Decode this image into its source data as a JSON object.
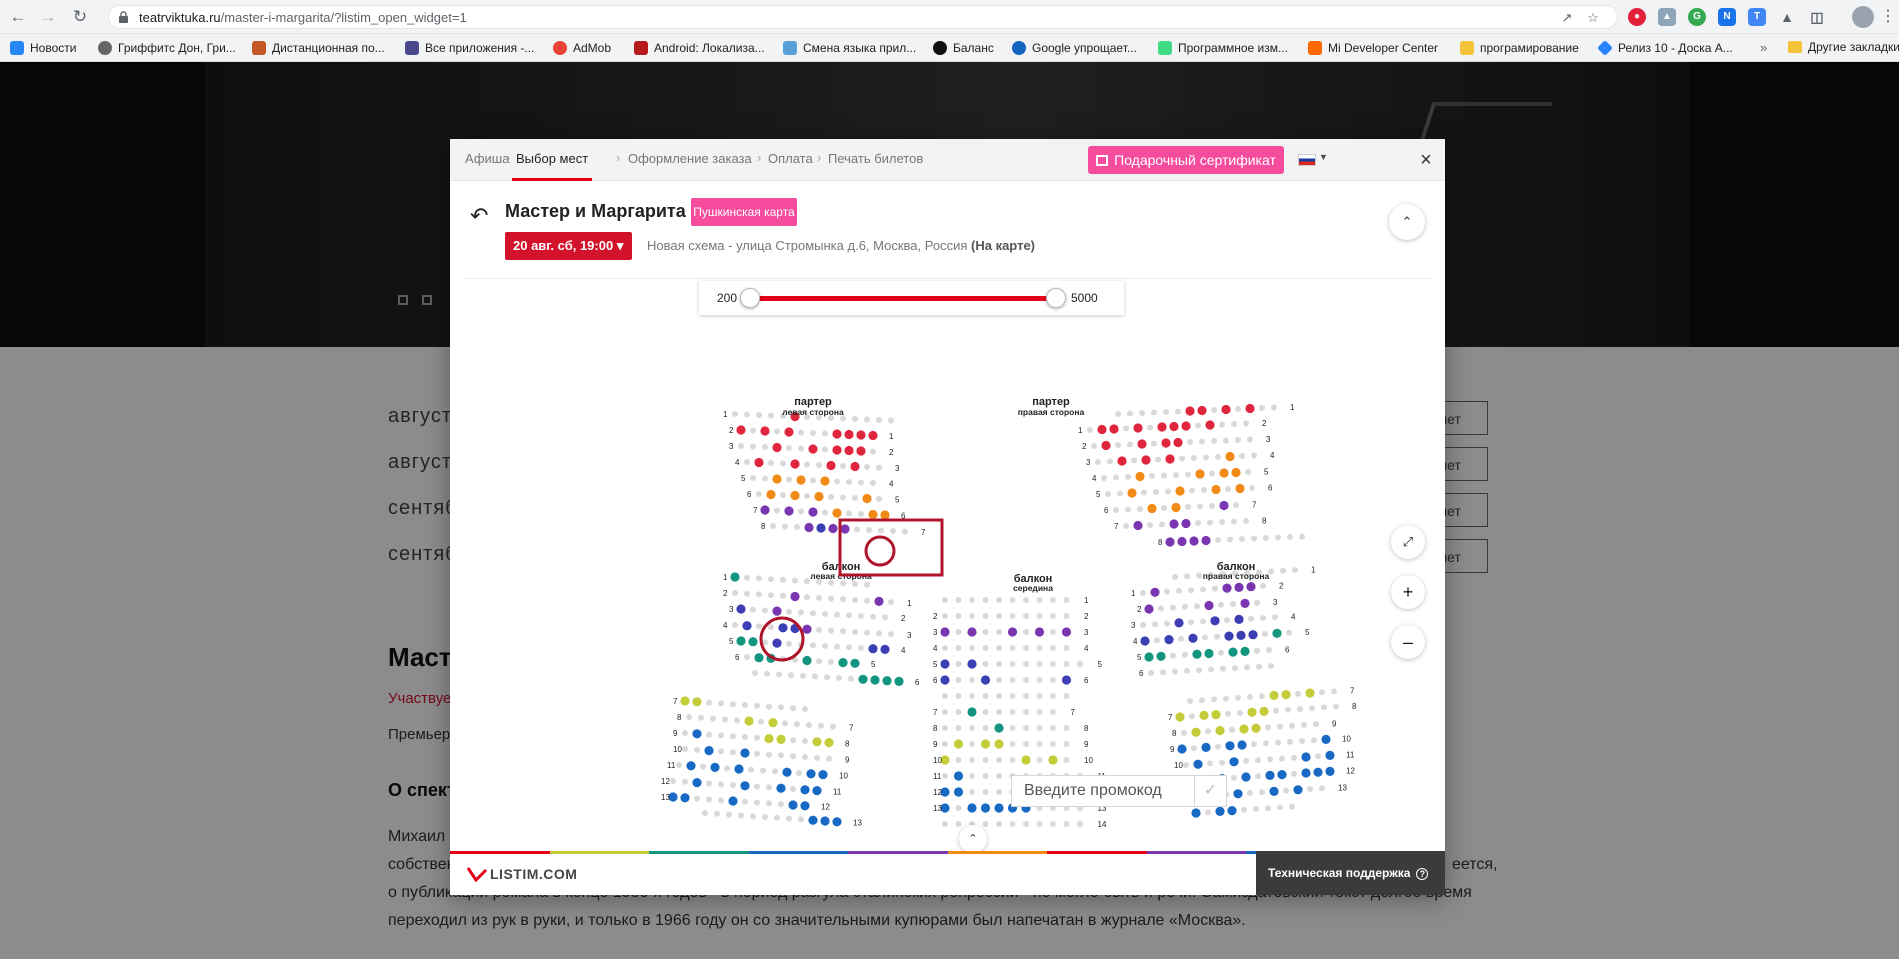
{
  "browser": {
    "url_domain": "teatrviktuka.ru",
    "url_path": "/master-i-margarita/?listim_open_widget=1",
    "bookmarks": [
      {
        "label": "Новости",
        "color": "#2787f5"
      },
      {
        "label": "Гриффитс Дон, Гри...",
        "color": "#666666"
      },
      {
        "label": "Дистанционная по...",
        "color": "#c2582a"
      },
      {
        "label": "Все приложения -...",
        "color": "#4a4a8a"
      },
      {
        "label": "AdMob",
        "color": "#ea4335"
      },
      {
        "label": "Android: Локализа...",
        "color": "#b71c1c"
      },
      {
        "label": "Смена языка прил...",
        "color": "#5aa0d8"
      },
      {
        "label": "Баланс",
        "color": "#111111"
      },
      {
        "label": "Google упрощает...",
        "color": "#1565c0"
      },
      {
        "label": "Программное изм...",
        "color": "#3ddc84"
      },
      {
        "label": "Mi Developer Center",
        "color": "#ff6900"
      },
      {
        "label": "програмирование",
        "color": "#f4c33a"
      },
      {
        "label": "Релиз 10 - Доска А...",
        "color": "#2684ff"
      }
    ],
    "bookmarks_more": "»",
    "bookmarks_other": "Другие закладки"
  },
  "page": {
    "date_rows": [
      "август",
      "август",
      "сентяб",
      "сентяб"
    ],
    "buy_label": "лет",
    "title": "Маст",
    "participates": "Участвуе",
    "premiere": "Премьер",
    "about_heading": "О спект",
    "paragraphs": [
      "Михаил А",
      "собствен",
      "о публикации романа в конце 1930-х годов - в период разгула сталинских репрессий - не могло быть и речи. Самиздатовский текст долгое время",
      "переходил из рук в руки, и только в 1966 году он со значительными купюрами был напечатан в журнале «Москва»."
    ],
    "para_right_fragment": "еется,"
  },
  "widget": {
    "steps": [
      "Афиша",
      "Выбор мест",
      "Оформление заказа",
      "Оплата",
      "Печать билетов"
    ],
    "active_step": "Выбор мест",
    "gift_button": "Подарочный сертификат",
    "close_icon": "×",
    "event_title": "Мастер и Маргарита",
    "pushkin_badge": "Пушкинская карта",
    "date_button": "20 авг. сб, 19:00",
    "venue": "Новая схема - улица Стромынка д.6, Москва, Россия",
    "venue_map_link": "(На карте)",
    "price_filter": {
      "min": "200",
      "max": "5000",
      "min_value": 200,
      "max_value": 5000
    },
    "sections": [
      {
        "title": "партер",
        "subtitle": "левая сторона"
      },
      {
        "title": "партер",
        "subtitle": "правая сторона"
      },
      {
        "title": "балкон",
        "subtitle": "левая сторона"
      },
      {
        "title": "балкон",
        "subtitle": "середина"
      },
      {
        "title": "балкон",
        "subtitle": "правая сторона"
      }
    ],
    "price_colors": {
      "red": "#e0263f",
      "orange": "#f18a16",
      "purple": "#7a36b1",
      "indigo": "#3b3fb3",
      "teal": "#13957f",
      "lime": "#c4cc3a",
      "blue": "#1769c4",
      "empty": "#d9d9d9"
    },
    "promo_placeholder": "Введите промокод",
    "support_button": "Техническая поддержка",
    "logo": "LISTIM.COM",
    "rainbow": [
      "#e2001a",
      "#c4cc3a",
      "#13957f",
      "#1769c4",
      "#7a36b1",
      "#f18a16",
      "#e2001a",
      "#7a36b1",
      "#1769c4",
      "#13957f"
    ]
  }
}
